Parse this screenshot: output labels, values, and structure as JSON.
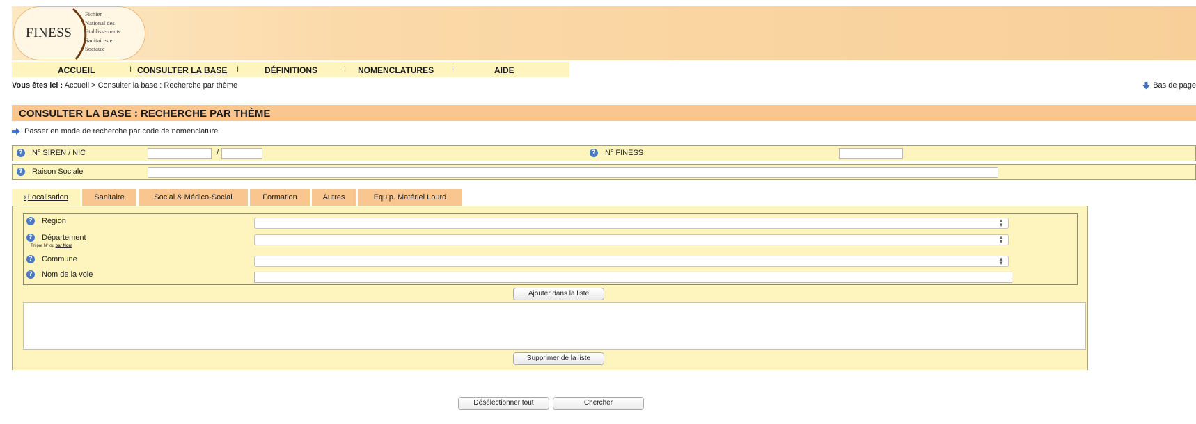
{
  "logo": {
    "main": "FINESS",
    "sub_lines": [
      "Fichier",
      "National des",
      "Etablissements",
      "Sanitaires et",
      "Sociaux"
    ]
  },
  "nav": {
    "items": [
      "ACCUEIL",
      "CONSULTER LA BASE",
      "DÉFINITIONS",
      "NOMENCLATURES",
      "AIDE"
    ],
    "separator": "I"
  },
  "breadcrumb": {
    "prefix": "Vous êtes ici :",
    "path": " Accueil > Consulter la base : Recherche par thème"
  },
  "bas_de_page": "Bas de page",
  "page_title": "CONSULTER LA BASE : RECHERCHE PAR THÈME",
  "mode_link": "Passer en mode de recherche par code de nomenclature",
  "siren": {
    "label": "N° SIREN /   NIC",
    "separator": "/",
    "siren_value": "",
    "nic_value": ""
  },
  "finess": {
    "label": "N° FINESS",
    "value": ""
  },
  "raison_sociale": {
    "label": "Raison Sociale",
    "value": ""
  },
  "tabs": [
    "Localisation",
    "Sanitaire",
    "Social & Médico-Social",
    "Formation",
    "Autres",
    "Equip. Matériel Lourd"
  ],
  "active_tab": "Localisation",
  "localisation": {
    "region_label": "Région",
    "departement_label": "Département",
    "tri_prefix": "Tri par N° ou",
    "tri_link": "par Nom",
    "commune_label": "Commune",
    "voie_label": "Nom de la voie",
    "region_value": "",
    "departement_value": "",
    "commune_value": "",
    "voie_value": ""
  },
  "buttons": {
    "ajouter": "Ajouter dans la liste",
    "supprimer": "Supprimer de la liste",
    "deselectionner": "Désélectionner tout",
    "chercher": "Chercher"
  },
  "colors": {
    "accent_orange": "#f9c690",
    "panel_yellow": "#fdf5bd",
    "arrow_blue": "#3b6fc9"
  }
}
